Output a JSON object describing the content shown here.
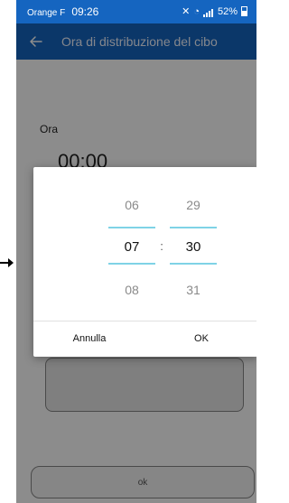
{
  "status_bar": {
    "carrier": "Orange F",
    "time": "09:26",
    "battery_percent": "52%"
  },
  "app_bar": {
    "title": "Ora di distribuzione del cibo",
    "back_icon": "arrow-left-icon"
  },
  "content": {
    "label": "Ora",
    "time_value": "00:00",
    "ok_label": "ok"
  },
  "dialog": {
    "hour": {
      "prev": "06",
      "current": "07",
      "next": "08"
    },
    "minute": {
      "prev": "29",
      "current": "30",
      "next": "31"
    },
    "separator": ":",
    "cancel_label": "Annulla",
    "ok_label": "OK"
  },
  "colors": {
    "primary": "#1565c0",
    "picker_line": "#7fd3e6",
    "dialog_bg": "#ffffff",
    "overlay": "rgba(0,0,0,0.45)"
  }
}
